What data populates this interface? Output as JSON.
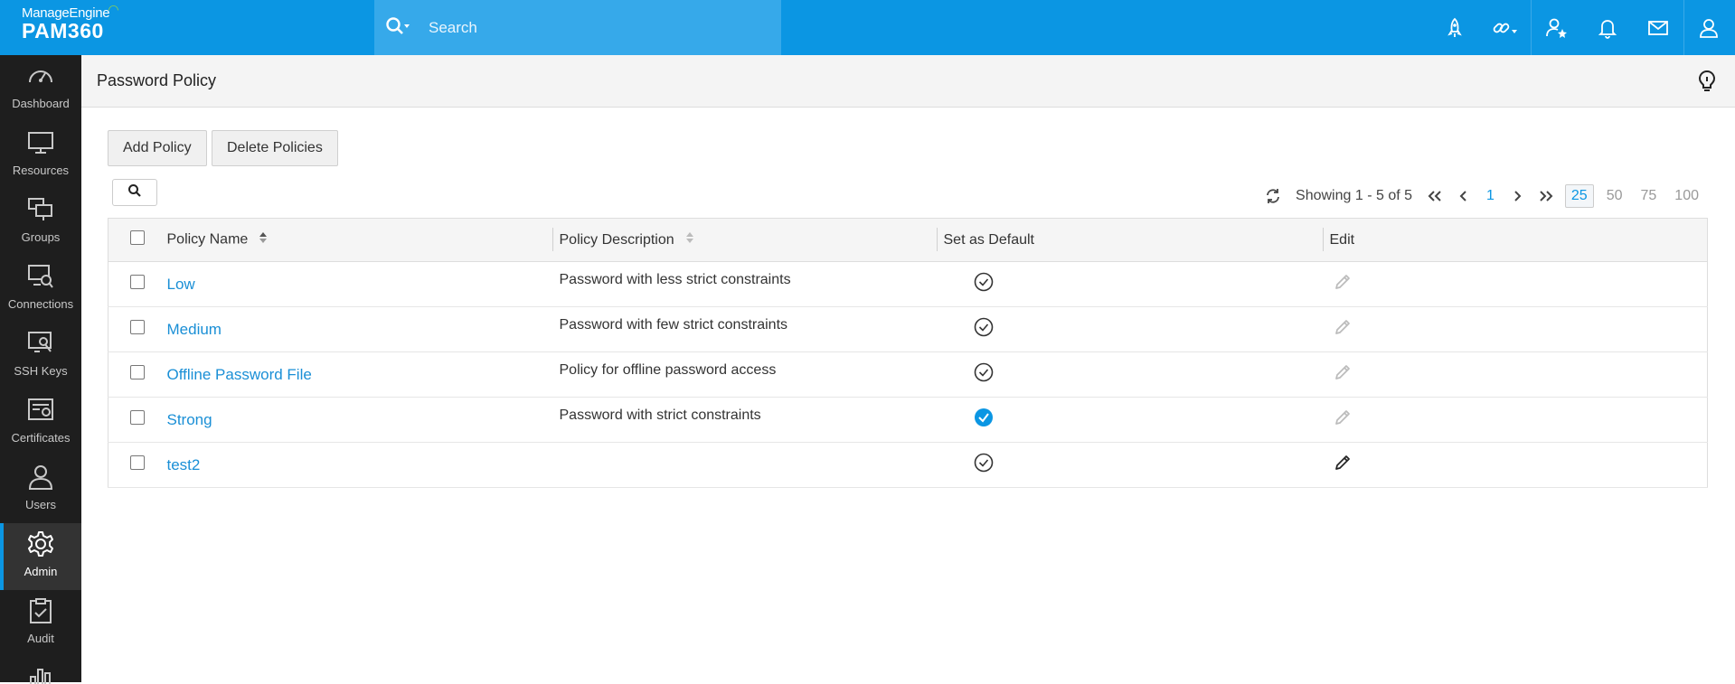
{
  "topbar": {
    "brand": "ManageEngine",
    "product": "PAM360",
    "search_placeholder": "Search",
    "icons": [
      "rocket-icon",
      "link-icon",
      "user-star-icon",
      "bell-icon",
      "mail-icon",
      "user-profile-icon"
    ]
  },
  "sidebar": {
    "items": [
      {
        "label": "Dashboard",
        "icon": "dashboard-icon"
      },
      {
        "label": "Resources",
        "icon": "monitor-icon"
      },
      {
        "label": "Groups",
        "icon": "groups-icon"
      },
      {
        "label": "Connections",
        "icon": "connections-icon"
      },
      {
        "label": "SSH Keys",
        "icon": "ssh-key-icon"
      },
      {
        "label": "Certificates",
        "icon": "certificate-icon"
      },
      {
        "label": "Users",
        "icon": "user-icon"
      },
      {
        "label": "Admin",
        "icon": "gear-icon",
        "active": true
      },
      {
        "label": "Audit",
        "icon": "clipboard-icon"
      }
    ]
  },
  "header": {
    "title": "Password Policy"
  },
  "toolbar": {
    "add_label": "Add Policy",
    "delete_label": "Delete Policies"
  },
  "pager": {
    "showing": "Showing 1 - 5 of 5",
    "page": "1",
    "sizes": [
      "25",
      "50",
      "75",
      "100"
    ],
    "selected_size": "25"
  },
  "table": {
    "columns": [
      "Policy Name",
      "Policy Description",
      "Set as Default",
      "Edit"
    ],
    "rows": [
      {
        "name": "Low",
        "description": "Password with less strict constraints",
        "is_default": false,
        "editable": false
      },
      {
        "name": "Medium",
        "description": "Password with few strict constraints",
        "is_default": false,
        "editable": false
      },
      {
        "name": "Offline Password File",
        "description": "Policy for offline password access",
        "is_default": false,
        "editable": false
      },
      {
        "name": "Strong",
        "description": "Password with strict constraints",
        "is_default": true,
        "editable": false
      },
      {
        "name": "test2",
        "description": "",
        "is_default": false,
        "editable": true
      }
    ]
  },
  "colors": {
    "accent": "#0b96e3",
    "sidebar": "#1e1e1e",
    "link": "#1a8fd6"
  }
}
